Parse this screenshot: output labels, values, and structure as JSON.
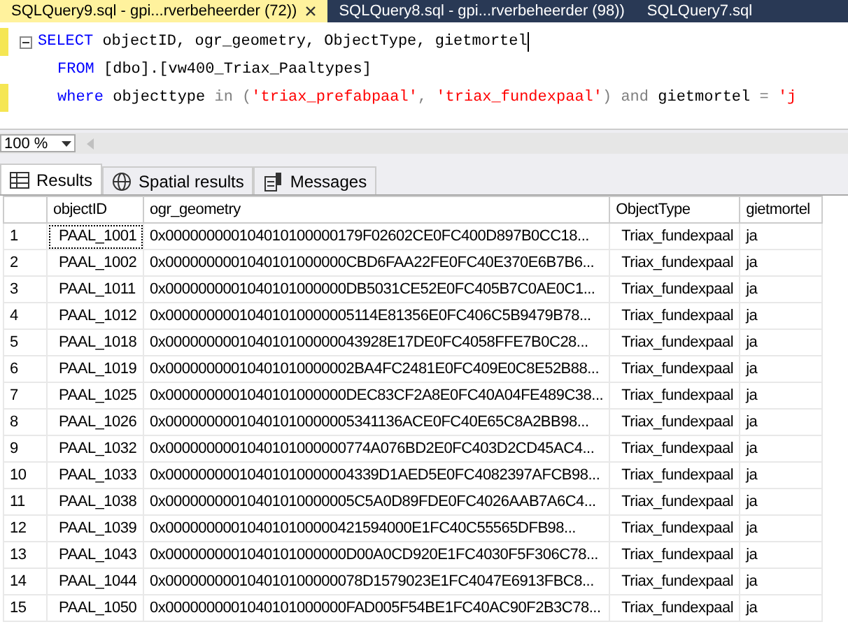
{
  "doc_tabs": [
    {
      "title": "SQLQuery9.sql - gpi...rverbeheerder (72))",
      "selected": true
    },
    {
      "title": "SQLQuery8.sql - gpi...rverbeheerder (98))",
      "selected": false
    },
    {
      "title": "SQLQuery7.sql",
      "selected": false
    }
  ],
  "editor": {
    "lines": [
      {
        "changed": true,
        "collapsible": true,
        "cursor": true,
        "tokens": [
          {
            "kind": "keyword",
            "text": "SELECT"
          },
          {
            "kind": "plain",
            "text": " objectID, ogr_geometry, ObjectType, gietmortel"
          }
        ]
      },
      {
        "changed": false,
        "collapsible": false,
        "cursor": false,
        "tokens": [
          {
            "kind": "keyword",
            "text": "FROM"
          },
          {
            "kind": "plain",
            "text": " [dbo].[vw400_Triax_Paaltypes]"
          }
        ]
      },
      {
        "changed": true,
        "collapsible": false,
        "cursor": false,
        "tokens": [
          {
            "kind": "keyword",
            "text": "where"
          },
          {
            "kind": "plain",
            "text": " objecttype "
          },
          {
            "kind": "operator",
            "text": "in ("
          },
          {
            "kind": "string",
            "text": "'triax_prefabpaal'"
          },
          {
            "kind": "operator",
            "text": ", "
          },
          {
            "kind": "string",
            "text": "'triax_fundexpaal'"
          },
          {
            "kind": "operator",
            "text": ") and"
          },
          {
            "kind": "plain",
            "text": " gietmortel "
          },
          {
            "kind": "operator",
            "text": "= "
          },
          {
            "kind": "string",
            "text": "'j"
          }
        ]
      }
    ]
  },
  "zoom": "100 %",
  "result_tabs": [
    {
      "kind": "grid",
      "label": "Results",
      "selected": true
    },
    {
      "kind": "globe",
      "label": "Spatial results",
      "selected": false
    },
    {
      "kind": "messages",
      "label": "Messages",
      "selected": false
    }
  ],
  "grid": {
    "columns": [
      "objectID",
      "ogr_geometry",
      "ObjectType",
      "gietmortel"
    ],
    "rows": [
      {
        "number": "1",
        "focused": true,
        "cells": [
          "PAAL_1001",
          "0x000000000104010100000179F02602CE0FC400D897B0CC18...",
          "Triax_fundexpaal",
          "ja"
        ]
      },
      {
        "number": "2",
        "focused": false,
        "cells": [
          "PAAL_1002",
          "0x0000000001040101000000CBD6FAA22FE0FC40E370E6B7B6...",
          "Triax_fundexpaal",
          "ja"
        ]
      },
      {
        "number": "3",
        "focused": false,
        "cells": [
          "PAAL_1011",
          "0x0000000001040101000000DB5031CE52E0FC405B7C0AE0C1...",
          "Triax_fundexpaal",
          "ja"
        ]
      },
      {
        "number": "4",
        "focused": false,
        "cells": [
          "PAAL_1012",
          "0x00000000010401010000005114E81356E0FC406C5B9479B78...",
          "Triax_fundexpaal",
          "ja"
        ]
      },
      {
        "number": "5",
        "focused": false,
        "cells": [
          "PAAL_1018",
          "0x000000000104010100000043928E17DE0FC4058FFE7B0C28...",
          "Triax_fundexpaal",
          "ja"
        ]
      },
      {
        "number": "6",
        "focused": false,
        "cells": [
          "PAAL_1019",
          "0x00000000010401010000002BA4FC2481E0FC409E0C8E52B88...",
          "Triax_fundexpaal",
          "ja"
        ]
      },
      {
        "number": "7",
        "focused": false,
        "cells": [
          "PAAL_1025",
          "0x0000000001040101000000DEC83CF2A8E0FC40A04FE489C38...",
          "Triax_fundexpaal",
          "ja"
        ]
      },
      {
        "number": "8",
        "focused": false,
        "cells": [
          "PAAL_1026",
          "0x00000000010401010000005341136ACE0FC40E65C8A2BB98...",
          "Triax_fundexpaal",
          "ja"
        ]
      },
      {
        "number": "9",
        "focused": false,
        "cells": [
          "PAAL_1032",
          "0x0000000001040101000000774A076BD2E0FC403D2CD45AC4...",
          "Triax_fundexpaal",
          "ja"
        ]
      },
      {
        "number": "10",
        "focused": false,
        "cells": [
          "PAAL_1033",
          "0x00000000010401010000004339D1AED5E0FC4082397AFCB98...",
          "Triax_fundexpaal",
          "ja"
        ]
      },
      {
        "number": "11",
        "focused": false,
        "cells": [
          "PAAL_1038",
          "0x00000000010401010000005C5A0D89FDE0FC4026AAB7A6C4...",
          "Triax_fundexpaal",
          "ja"
        ]
      },
      {
        "number": "12",
        "focused": false,
        "cells": [
          "PAAL_1039",
          "0x000000000104010100000421594000E1FC40C55565DFB98...",
          "Triax_fundexpaal",
          "ja"
        ]
      },
      {
        "number": "13",
        "focused": false,
        "cells": [
          "PAAL_1043",
          "0x0000000001040101000000D00A0CD920E1FC4030F5F306C78...",
          "Triax_fundexpaal",
          "ja"
        ]
      },
      {
        "number": "14",
        "focused": false,
        "cells": [
          "PAAL_1044",
          "0x000000000104010100000078D1579023E1FC4047E6913FBC8...",
          "Triax_fundexpaal",
          "ja"
        ]
      },
      {
        "number": "15",
        "focused": false,
        "cells": [
          "PAAL_1050",
          "0x0000000001040101000000FAD005F54BE1FC40AC90F2B3C78...",
          "Triax_fundexpaal",
          "ja"
        ]
      }
    ]
  }
}
